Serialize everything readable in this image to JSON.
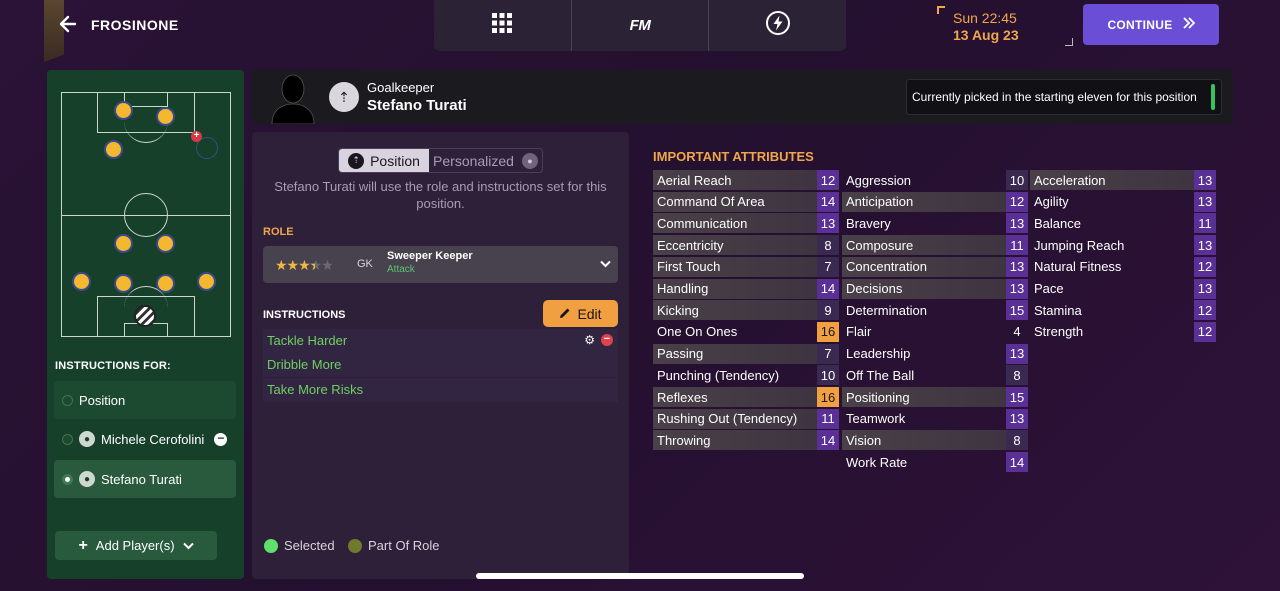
{
  "header": {
    "club_name": "FROSINONE",
    "nav": [
      {
        "name": "grid-menu-icon"
      },
      {
        "label": "FM"
      },
      {
        "name": "lightning-icon"
      }
    ],
    "time": "Sun 22:45",
    "date": "13 Aug 23",
    "continue_label": "CONTINUE",
    "accent": "#6a4fd6"
  },
  "left_panel": {
    "instructions_for": "INSTRUCTIONS FOR:",
    "options": [
      {
        "label": "Position",
        "selected": false
      },
      {
        "label": "Michele Cerofolini",
        "selected": false
      },
      {
        "label": "Stefano Turati",
        "selected": true
      }
    ],
    "add_label": "Add Player(s)"
  },
  "player": {
    "position": "Goalkeeper",
    "name": "Stefano Turati",
    "picked_text": "Currently picked in the starting eleven for this position"
  },
  "middle": {
    "toggle_on": "Position",
    "toggle_off": "Personalized",
    "description": "Stefano Turati will use the role and instructions set for this position.",
    "role_heading": "ROLE",
    "role_short": "GK",
    "role_name": "Sweeper Keeper",
    "role_duty": "Attack",
    "role_stars": 3.5,
    "instructions_heading": "INSTRUCTIONS",
    "edit_label": "Edit",
    "instructions": [
      "Tackle Harder",
      "Dribble More",
      "Take More Risks"
    ],
    "legend": [
      {
        "label": "Selected",
        "color": "#5fe06a"
      },
      {
        "label": "Part Of Role",
        "color": "#6f7a2c"
      }
    ]
  },
  "attributes": {
    "title": "IMPORTANT ATTRIBUTES",
    "columns": [
      [
        {
          "name": "Aerial Reach",
          "value": "12",
          "key": true
        },
        {
          "name": "Command Of Area",
          "value": "14",
          "key": true
        },
        {
          "name": "Communication",
          "value": "13",
          "key": true
        },
        {
          "name": "Eccentricity",
          "value": "8",
          "key": true
        },
        {
          "name": "First Touch",
          "value": "7",
          "key": true
        },
        {
          "name": "Handling",
          "value": "14",
          "key": true
        },
        {
          "name": "Kicking",
          "value": "9",
          "key": true
        },
        {
          "name": "One On Ones",
          "value": "16",
          "key": false
        },
        {
          "name": "Passing",
          "value": "7",
          "key": true
        },
        {
          "name": "Punching (Tendency)",
          "value": "10",
          "key": false
        },
        {
          "name": "Reflexes",
          "value": "16",
          "key": true
        },
        {
          "name": "Rushing Out (Tendency)",
          "value": "11",
          "key": true
        },
        {
          "name": "Throwing",
          "value": "14",
          "key": true
        }
      ],
      [
        {
          "name": "Aggression",
          "value": "10",
          "key": false
        },
        {
          "name": "Anticipation",
          "value": "12",
          "key": true
        },
        {
          "name": "Bravery",
          "value": "13",
          "key": false
        },
        {
          "name": "Composure",
          "value": "11",
          "key": true
        },
        {
          "name": "Concentration",
          "value": "13",
          "key": true
        },
        {
          "name": "Decisions",
          "value": "13",
          "key": true
        },
        {
          "name": "Determination",
          "value": "15",
          "key": false
        },
        {
          "name": "Flair",
          "value": "4",
          "key": false
        },
        {
          "name": "Leadership",
          "value": "13",
          "key": false
        },
        {
          "name": "Off The Ball",
          "value": "8",
          "key": false
        },
        {
          "name": "Positioning",
          "value": "15",
          "key": true
        },
        {
          "name": "Teamwork",
          "value": "13",
          "key": false
        },
        {
          "name": "Vision",
          "value": "8",
          "key": true
        },
        {
          "name": "Work Rate",
          "value": "14",
          "key": false
        }
      ],
      [
        {
          "name": "Acceleration",
          "value": "13",
          "key": true
        },
        {
          "name": "Agility",
          "value": "13",
          "key": false
        },
        {
          "name": "Balance",
          "value": "11",
          "key": false
        },
        {
          "name": "Jumping Reach",
          "value": "13",
          "key": false
        },
        {
          "name": "Natural Fitness",
          "value": "12",
          "key": false
        },
        {
          "name": "Pace",
          "value": "13",
          "key": false
        },
        {
          "name": "Stamina",
          "value": "12",
          "key": false
        },
        {
          "name": "Strength",
          "value": "12",
          "key": false
        }
      ]
    ]
  }
}
